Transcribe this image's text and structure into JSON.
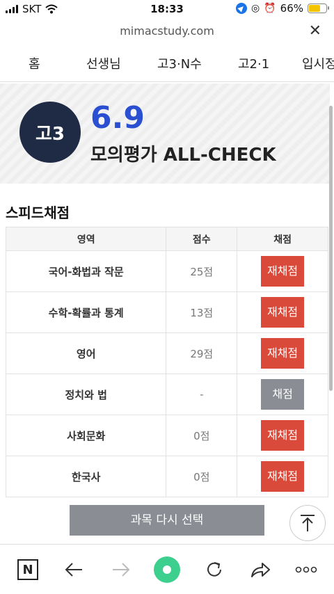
{
  "status_bar": {
    "carrier": "SKT",
    "time": "18:33",
    "battery": "66%",
    "battery_level": 0.66
  },
  "url_bar": {
    "url": "mimacstudy.com"
  },
  "nav_tabs": [
    "홈",
    "선생님",
    "고3·N수",
    "고2·1",
    "입시정"
  ],
  "hero": {
    "badge": "고3",
    "date": "6.9",
    "exam_title": "모의평가 ALL-CHECK"
  },
  "speed_grading": {
    "title": "스피드채점",
    "headers": [
      "영역",
      "점수",
      "채점"
    ],
    "rows": [
      {
        "subject": "국어-화법과 작문",
        "score": "25점",
        "action": "재채점"
      },
      {
        "subject": "수학-확률과 통계",
        "score": "13점",
        "action": "재채점"
      },
      {
        "subject": "영어",
        "score": "29점",
        "action": "재채점"
      },
      {
        "subject": "정치와 법",
        "score": "-",
        "action": "채점"
      },
      {
        "subject": "사회문화",
        "score": "0점",
        "action": "재채점"
      },
      {
        "subject": "한국사",
        "score": "0점",
        "action": "재채점"
      }
    ],
    "reselect_button": "과목 다시 선택"
  },
  "colors": {
    "accent_blue": "#2a4fd1",
    "badge_navy": "#1f2a44",
    "regrade_red": "#d94a3a",
    "neutral_gray": "#8a8d94"
  }
}
